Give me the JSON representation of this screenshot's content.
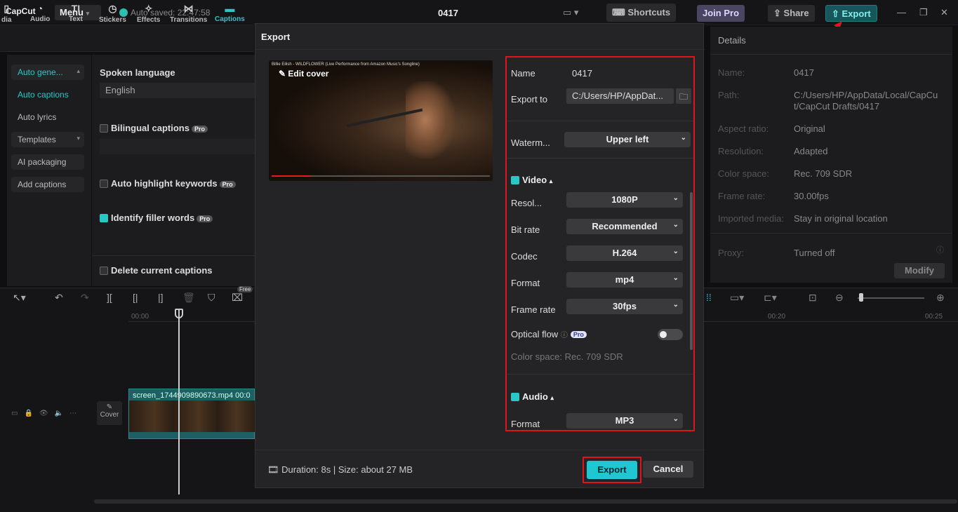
{
  "app": {
    "logo": "CapCut",
    "menu_label": "Menu",
    "autosave": "Auto saved: 22:47:58",
    "project_title": "0417",
    "shortcuts_label": "Shortcuts",
    "joinpro_label": "Join Pro",
    "share_label": "Share",
    "export_label": "Export"
  },
  "toolbar": {
    "items": [
      {
        "label": "dia",
        "icon": "media-icon"
      },
      {
        "label": "Audio",
        "icon": "audio-icon"
      },
      {
        "label": "Text",
        "icon": "text-icon"
      },
      {
        "label": "Stickers",
        "icon": "stickers-icon"
      },
      {
        "label": "Effects",
        "icon": "effects-icon"
      },
      {
        "label": "Transitions",
        "icon": "transitions-icon"
      },
      {
        "label": "Captions",
        "icon": "captions-icon"
      }
    ]
  },
  "sidebar": {
    "items": [
      {
        "label": "Auto gene..."
      },
      {
        "label": "Auto captions"
      },
      {
        "label": "Auto lyrics"
      },
      {
        "label": "Templates"
      },
      {
        "label": "AI packaging"
      },
      {
        "label": "Add captions"
      }
    ]
  },
  "captions_panel": {
    "spoken_language_label": "Spoken language",
    "spoken_language_value": "English",
    "bilingual": "Bilingual captions",
    "highlight": "Auto highlight keywords",
    "filler": "Identify filler words",
    "delete": "Delete current captions",
    "pro": "Pro"
  },
  "details": {
    "title": "Details",
    "rows": [
      {
        "key": "Name:",
        "value": "0417"
      },
      {
        "key": "Path:",
        "value": "C:/Users/HP/AppData/Local/CapCut/CapCut Drafts/0417"
      },
      {
        "key": "Aspect ratio:",
        "value": "Original"
      },
      {
        "key": "Resolution:",
        "value": "Adapted"
      },
      {
        "key": "Color space:",
        "value": "Rec. 709 SDR"
      },
      {
        "key": "Frame rate:",
        "value": "30.00fps"
      },
      {
        "key": "Imported media:",
        "value": "Stay in original location"
      },
      {
        "key": "Proxy:",
        "value": "Turned off"
      }
    ],
    "modify_label": "Modify"
  },
  "timeline": {
    "time_start": "00:00",
    "time_20": "00:20",
    "time_25": "00:25",
    "clip_label": "screen_1744909890673.mp4   00:0",
    "cover_label": "Cover",
    "free_badge": "Free"
  },
  "export_dialog": {
    "title": "Export",
    "preview_title": "Billie Eilish - WILDFLOWER (Live Performance from Amazon Music's Songline)",
    "preview_edit": "Edit cover",
    "name_label": "Name",
    "name_value": "0417",
    "export_to_label": "Export to",
    "export_to_value": "C:/Users/HP/AppDat...",
    "watermark_label": "Waterm...",
    "watermark_value": "Upper left",
    "video_section": "Video",
    "resolution_label": "Resol...",
    "resolution_value": "1080P",
    "bitrate_label": "Bit rate",
    "bitrate_value": "Recommended",
    "codec_label": "Codec",
    "codec_value": "H.264",
    "format_label": "Format",
    "format_value": "mp4",
    "framerate_label": "Frame rate",
    "framerate_value": "30fps",
    "optical_flow_label": "Optical flow",
    "pro": "Pro",
    "color_space": "Color space: Rec. 709 SDR",
    "audio_section": "Audio",
    "audio_format_label": "Format",
    "audio_format_value": "MP3",
    "footer_info": "Duration: 8s | Size: about 27 MB",
    "export_button": "Export",
    "cancel_button": "Cancel"
  },
  "colors": {
    "accent": "#20c6d2",
    "highlight_border": "#e0141e"
  }
}
